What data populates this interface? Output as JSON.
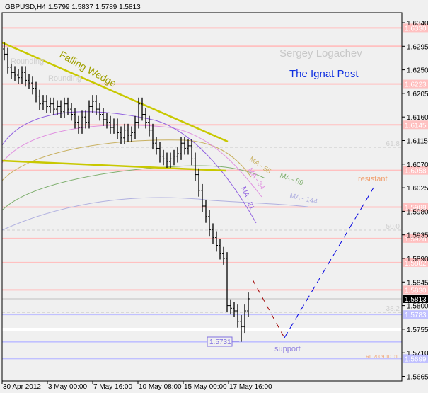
{
  "header": {
    "symbol": "GBPUSD,H4",
    "ohlc": "1.5799 1.5837 1.5789 1.5813"
  },
  "chart_data": {
    "type": "ohlc",
    "title": "GBPUSD,H4",
    "ylim": [
      1.5645,
      1.6362
    ],
    "y_ticks": [
      "1.6340",
      "1.6295",
      "1.6250",
      "1.6205",
      "1.6160",
      "1.6115",
      "1.6070",
      "1.6025",
      "1.5980",
      "1.5935",
      "1.5890",
      "1.5845",
      "1.5800",
      "1.5755",
      "1.5710",
      "1.5665"
    ],
    "x_ticks": [
      "30 Apr 2012",
      "3 May 00:00",
      "7 May 16:00",
      "10 May 08:00",
      "15 May 00:00",
      "17 May 16:00"
    ],
    "close": [
      1.628,
      1.6255,
      1.6245,
      1.624,
      1.6235,
      1.6245,
      1.623,
      1.6225,
      1.6215,
      1.62,
      1.6185,
      1.619,
      1.618,
      1.6185,
      1.6175,
      1.618,
      1.617,
      1.6185,
      1.6175,
      1.6165,
      1.615,
      1.614,
      1.616,
      1.615,
      1.618,
      1.619,
      1.6175,
      1.6165,
      1.6155,
      1.615,
      1.614,
      1.6145,
      1.613,
      1.612,
      1.6135,
      1.6125,
      1.613,
      1.615,
      1.6185,
      1.6165,
      1.615,
      1.6135,
      1.611,
      1.61,
      1.6085,
      1.608,
      1.6075,
      1.608,
      1.6085,
      1.609,
      1.611,
      1.61,
      1.6105,
      1.608,
      1.605,
      1.602,
      1.599,
      1.597,
      1.5945,
      1.593,
      1.5915,
      1.59,
      1.589,
      1.58,
      1.5795,
      1.579,
      1.577,
      1.576,
      1.579,
      1.5813
    ],
    "wick": 0.0012,
    "lowest": {
      "value": 1.5731,
      "label": "1.5731",
      "bar": 67
    },
    "current_price": {
      "value": 1.5813,
      "label": "1.5813"
    },
    "resistance_levels": [
      {
        "value": 1.633,
        "label": "1.6330"
      },
      {
        "value": 1.6295,
        "label": ""
      },
      {
        "value": 1.6223,
        "label": "1.6223"
      },
      {
        "value": 1.6145,
        "label": "1.6145"
      },
      {
        "value": 1.6058,
        "label": "1.6058"
      },
      {
        "value": 1.5988,
        "label": "1.5988"
      },
      {
        "value": 1.5928,
        "label": "1.5928"
      },
      {
        "value": 1.5882,
        "label": "1.5882"
      },
      {
        "value": 1.583,
        "label": "1.5830"
      }
    ],
    "support_levels": [
      {
        "value": 1.5783,
        "label": "1.5783"
      },
      {
        "value": 1.5731,
        "label": ""
      },
      {
        "value": 1.5699,
        "label": "1.5699"
      }
    ],
    "fibonacci": [
      {
        "value": 1.6102,
        "label": "61.8"
      },
      {
        "value": 1.5944,
        "label": "50.0"
      },
      {
        "value": 1.5787,
        "label": "38.2"
      }
    ],
    "annotations": {
      "pattern": "Falling Wedge",
      "rounding_1": "Rounding",
      "rounding_2": "Rounding",
      "author": "Sergey Logachev",
      "publisher": "The Ignat Post",
      "resistant": "resistant",
      "support": "support",
      "rl": "RL  2009.10.01",
      "ma21": "MA - 21",
      "ma34": "MA - 34",
      "ma55": "MA - 55",
      "ma89": "MA - 89",
      "ma144": "MA - 144"
    },
    "colors": {
      "resistance": "#ffc0c0",
      "support": "#c0c0ff",
      "wedge": "#c8c800",
      "ma21": "#9060e0",
      "ma34": "#e090e0",
      "ma55": "#c8b060",
      "ma89": "#80b070",
      "ma144": "#b0b0e0",
      "forecast_down": "#a00000",
      "forecast_up": "#0000e0"
    }
  }
}
